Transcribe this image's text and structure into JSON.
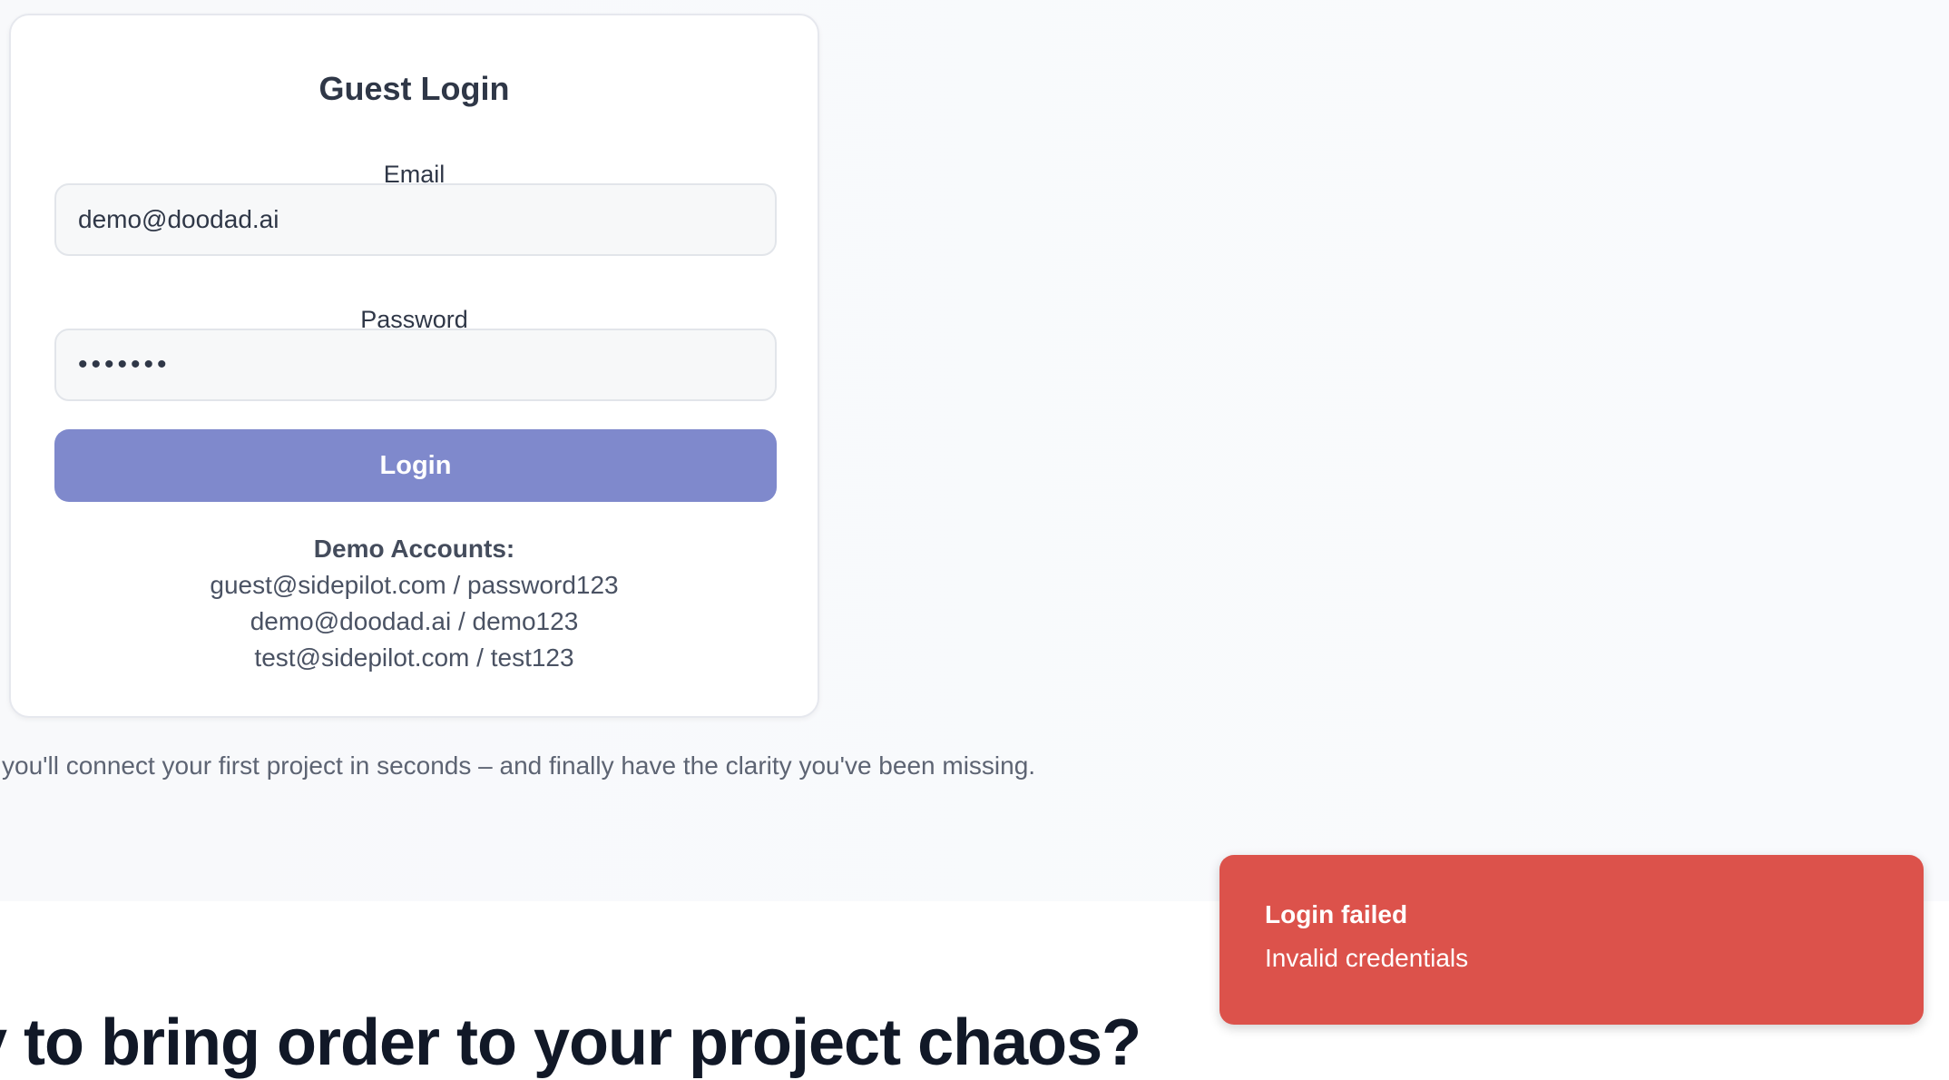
{
  "login_card": {
    "title": "Guest Login",
    "email_label": "Email",
    "email_value": "demo@doodad.ai",
    "password_label": "Password",
    "password_masked": "•••••••",
    "login_button": "Login",
    "demo_heading": "Demo Accounts:",
    "demo_accounts": [
      "guest@sidepilot.com / password123",
      "demo@doodad.ai / demo123",
      "test@sidepilot.com / test123"
    ]
  },
  "tagline": "you'll connect your first project in seconds – and finally have the clarity you've been missing.",
  "cta_heading": "y to bring order to your project chaos?",
  "toast": {
    "title": "Login failed",
    "message": "Invalid credentials",
    "color": "#dc524b"
  },
  "colors": {
    "button": "#7f89cc",
    "page_background": "#f8f9fb"
  }
}
